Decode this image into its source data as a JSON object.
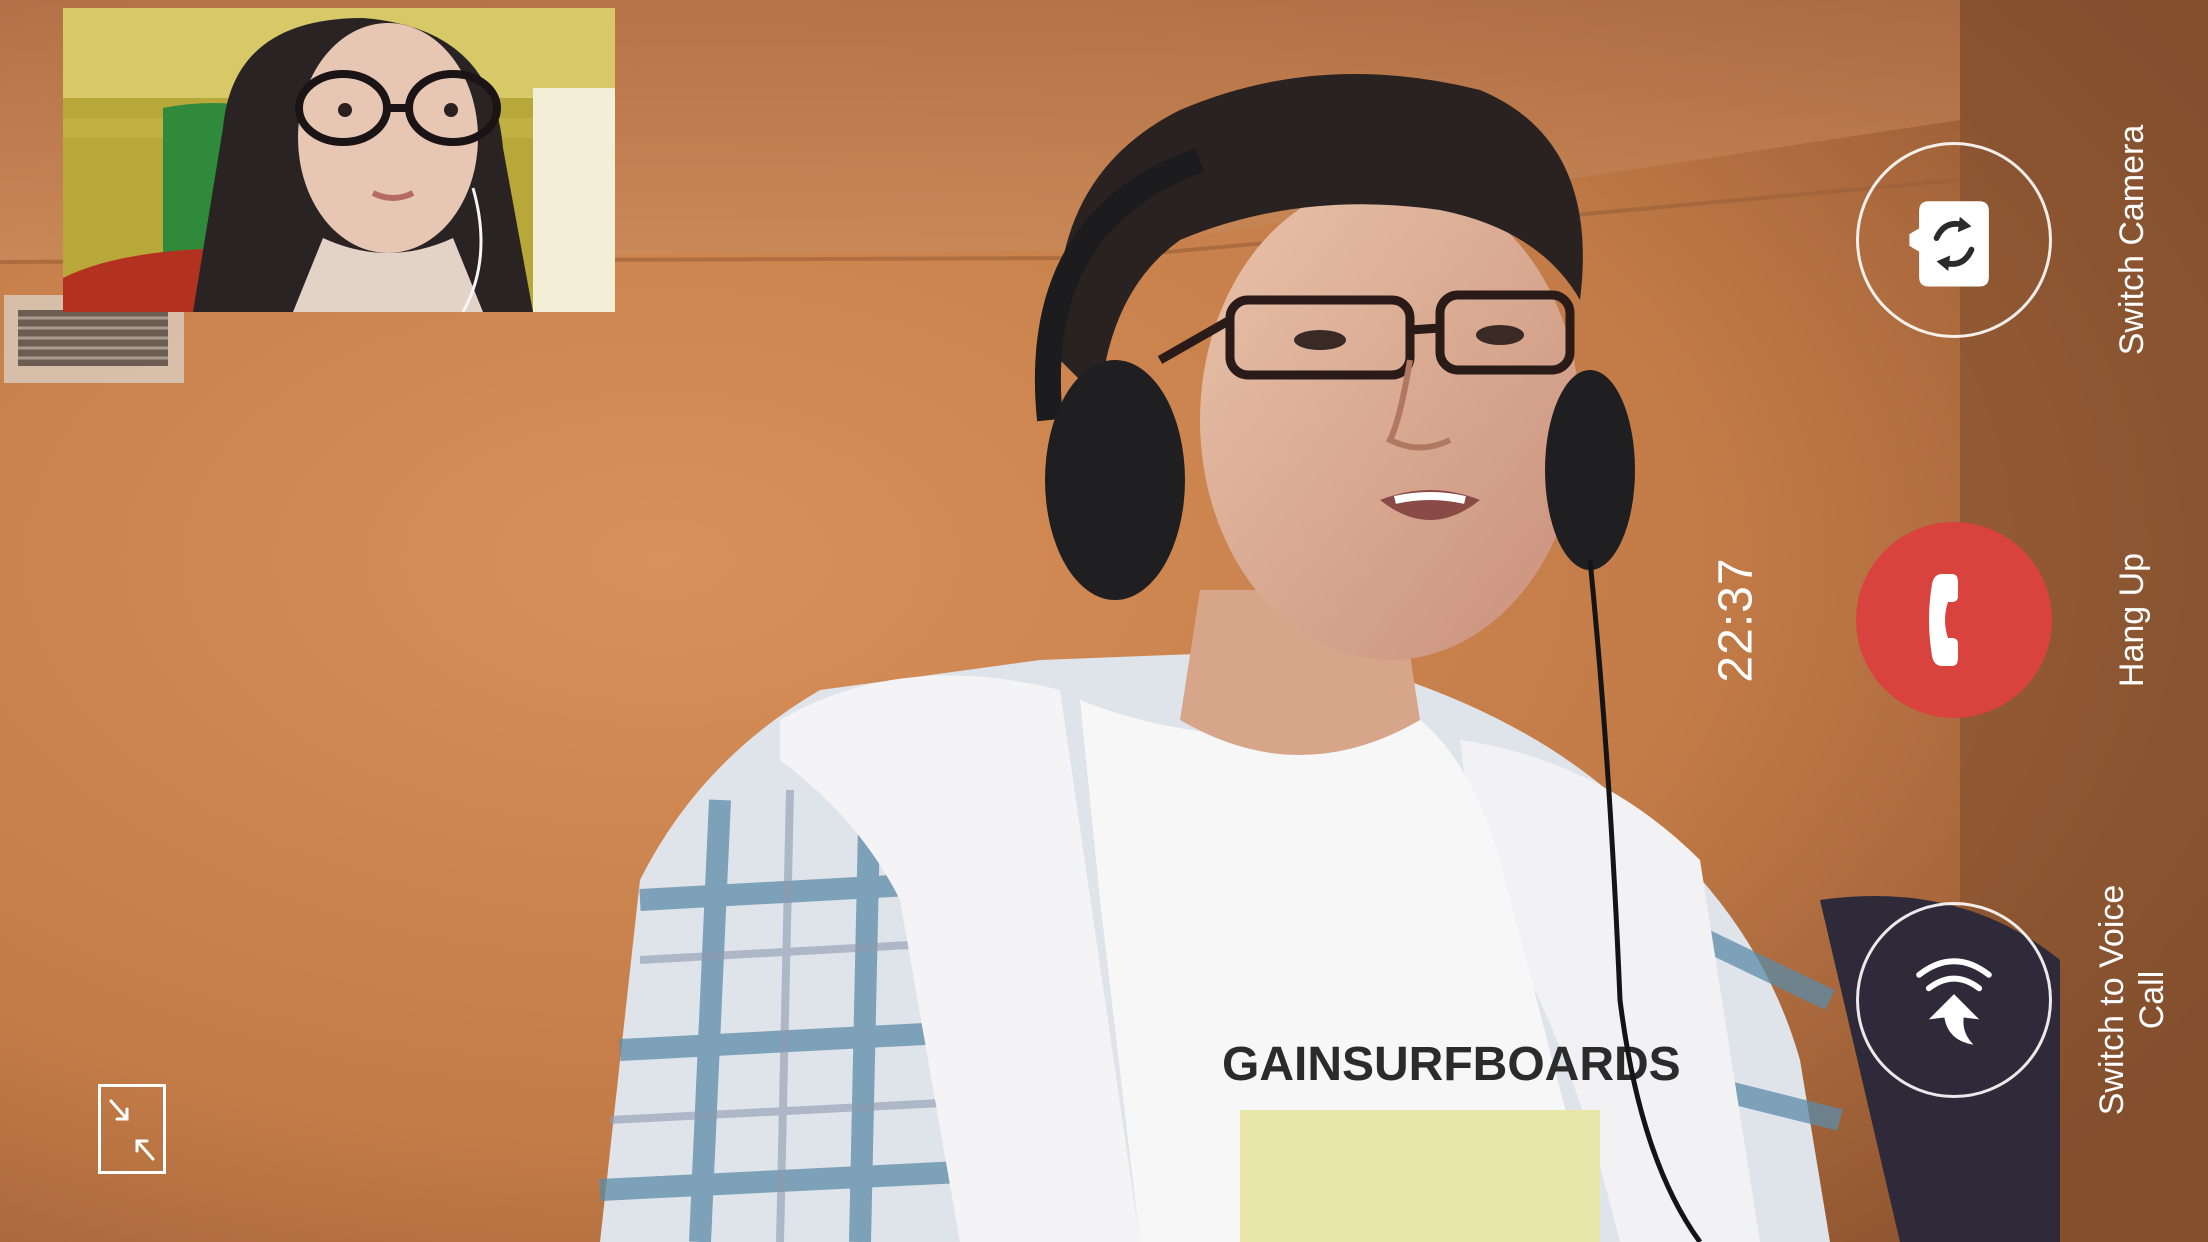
{
  "call": {
    "timer": "22:37"
  },
  "controls": {
    "switch_camera_label": "Switch Camera",
    "hang_up_label": "Hang Up",
    "switch_voice_label": "Switch to Voice Call"
  },
  "remote_video": {
    "shirt_text": "GAINSURFBOARDS"
  },
  "icons": {
    "switch_camera": "camera-rotate-icon",
    "hang_up": "phone-icon",
    "switch_voice": "voice-call-arrow-icon",
    "minimize": "minimize-arrows-icon"
  },
  "colors": {
    "hang_up": "#d8433e",
    "controls": "#ffffff"
  }
}
